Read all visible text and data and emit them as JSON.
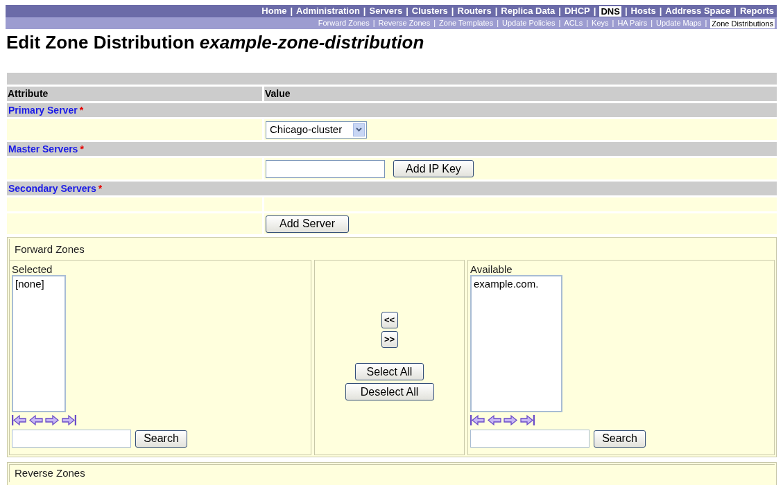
{
  "nav": {
    "items": [
      {
        "label": "Home",
        "selected": false
      },
      {
        "label": "Administration",
        "selected": false
      },
      {
        "label": "Servers",
        "selected": false
      },
      {
        "label": "Clusters",
        "selected": false
      },
      {
        "label": "Routers",
        "selected": false
      },
      {
        "label": "Replica Data",
        "selected": false
      },
      {
        "label": "DHCP",
        "selected": false
      },
      {
        "label": "DNS",
        "selected": true
      },
      {
        "label": "Hosts",
        "selected": false
      },
      {
        "label": "Address Space",
        "selected": false
      },
      {
        "label": "Reports",
        "selected": false
      }
    ],
    "subitems": [
      {
        "label": "Forward Zones",
        "selected": false
      },
      {
        "label": "Reverse Zones",
        "selected": false
      },
      {
        "label": "Zone Templates",
        "selected": false
      },
      {
        "label": "Update Policies",
        "selected": false
      },
      {
        "label": "ACLs",
        "selected": false
      },
      {
        "label": "Keys",
        "selected": false
      },
      {
        "label": "HA Pairs",
        "selected": false
      },
      {
        "label": "Update Maps",
        "selected": false
      },
      {
        "label": "Zone Distributions",
        "selected": true
      }
    ],
    "separator": "|"
  },
  "title": "Edit Zone Distribution *example-zone-distribution*",
  "table": {
    "columns": [
      "Attribute",
      "Value"
    ],
    "primary_server": {
      "label": "Primary Server",
      "required_mark": "*",
      "value": "Chicago-cluster"
    },
    "master_servers": {
      "label": "Master Servers",
      "required_mark": "*",
      "button": "Add IP Key"
    },
    "secondary_servers": {
      "label": "Secondary Servers",
      "required_mark": "*",
      "button": "Add Server"
    }
  },
  "forward_zones": {
    "title": "Forward Zones",
    "selected": {
      "label": "Selected",
      "items": [
        "[none]"
      ],
      "search_button": "Search"
    },
    "controls": {
      "move_left": "<<",
      "move_right": ">>",
      "select_all": "Select All",
      "deselect_all": "Deselect All"
    },
    "available": {
      "label": "Available",
      "items": [
        "example.com."
      ],
      "search_button": "Search"
    }
  },
  "reverse_zones": {
    "title": "Reverse Zones"
  }
}
